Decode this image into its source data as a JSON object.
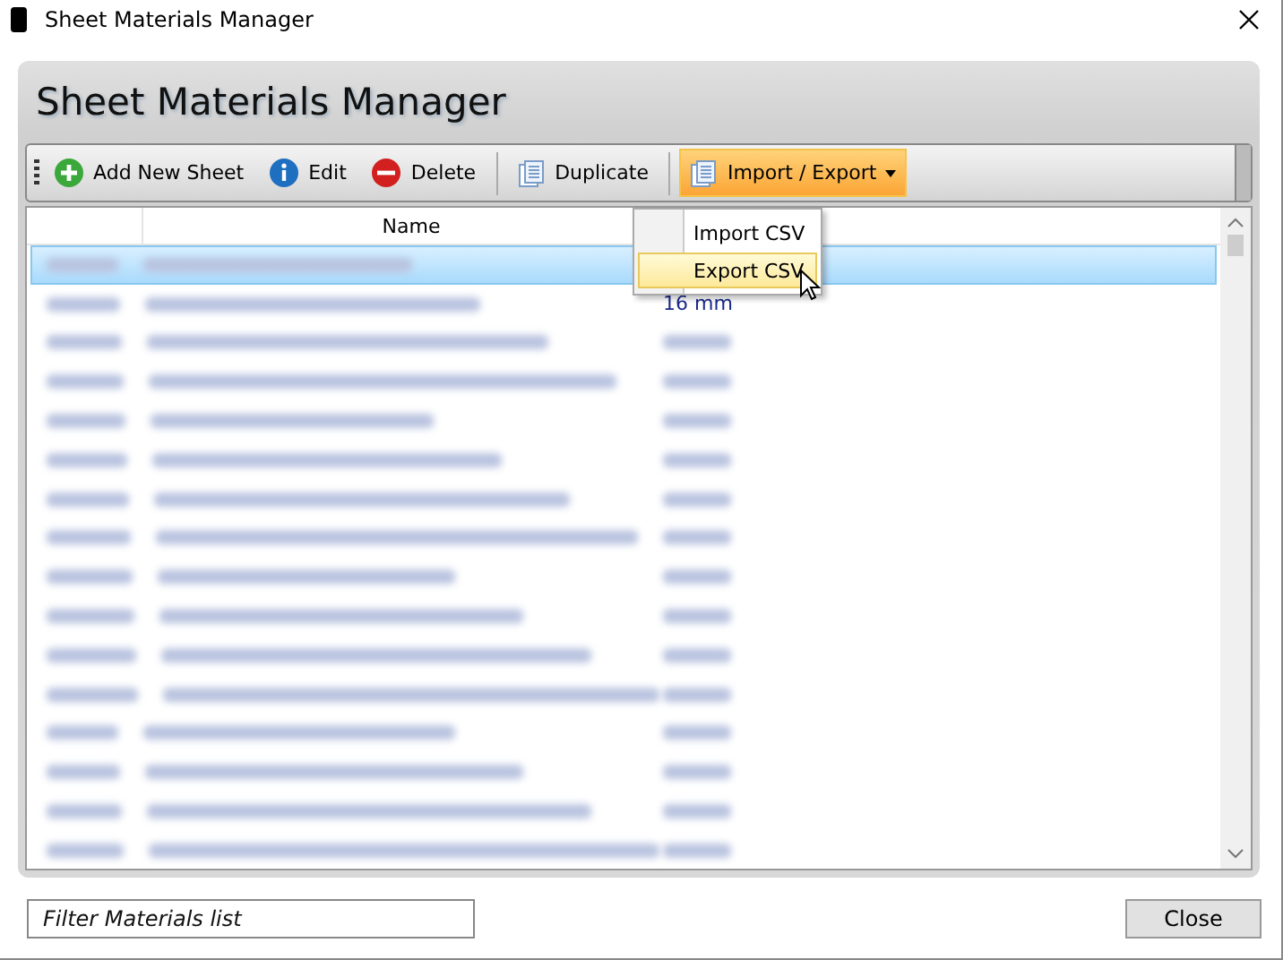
{
  "window": {
    "title": "Sheet Materials Manager"
  },
  "header": {
    "title": "Sheet Materials Manager"
  },
  "toolbar": [
    {
      "kind": "add",
      "label": "Add New Sheet",
      "highlighted": false
    },
    {
      "kind": "info",
      "label": "Edit",
      "highlighted": false
    },
    {
      "kind": "delete",
      "label": "Delete",
      "highlighted": false
    },
    {
      "kind": "separator"
    },
    {
      "kind": "copy",
      "label": "Duplicate",
      "highlighted": false
    },
    {
      "kind": "separator"
    },
    {
      "kind": "dropdown",
      "label": "Import / Export",
      "highlighted": true
    }
  ],
  "menu": [
    {
      "label": "Import CSV",
      "selected": false
    },
    {
      "label": "Export CSV",
      "selected": true
    }
  ],
  "table": {
    "columns": [
      "Name"
    ],
    "rows": [
      {
        "selected": true
      },
      {
        "selected": false,
        "size": "16 mm"
      },
      {
        "selected": false
      },
      {
        "selected": false
      },
      {
        "selected": false
      },
      {
        "selected": false
      },
      {
        "selected": false
      },
      {
        "selected": false
      },
      {
        "selected": false
      },
      {
        "selected": false
      },
      {
        "selected": false
      },
      {
        "selected": false
      },
      {
        "selected": false
      },
      {
        "selected": false
      },
      {
        "selected": false
      },
      {
        "selected": false
      }
    ]
  },
  "filter": {
    "placeholder": "Filter Materials list"
  },
  "buttons": [
    "Close"
  ]
}
